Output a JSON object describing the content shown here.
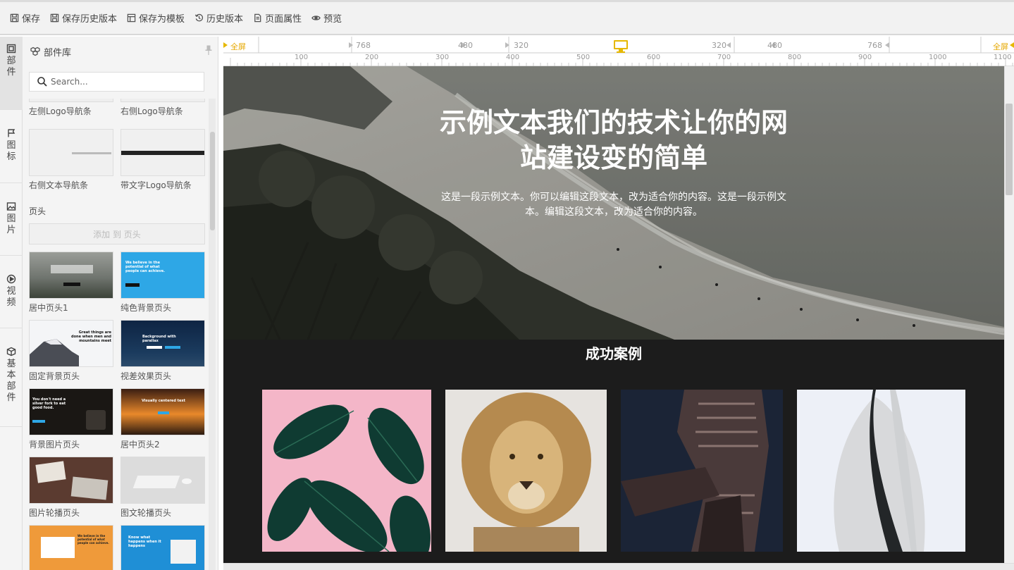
{
  "toolbar": {
    "save": "保存",
    "save_history": "保存历史版本",
    "save_template": "保存为模板",
    "history": "历史版本",
    "page_props": "页面属性",
    "preview": "预览"
  },
  "rail": {
    "tabs": [
      "部件",
      "图标",
      "图片",
      "视频",
      "基本部件"
    ]
  },
  "panel": {
    "title": "部件库",
    "search_placeholder": "Search...",
    "nav_items": [
      "左侧Logo导航条",
      "右侧Logo导航条",
      "右侧文本导航条",
      "带文字Logo导航条"
    ],
    "section_header": "页头",
    "add_to_header": "添加 到 页头",
    "header_items": [
      "居中页头1",
      "纯色背景页头",
      "固定背景页头",
      "视差效果页头",
      "背景图片页头",
      "居中页头2",
      "图片轮播页头",
      "图文轮播页头"
    ],
    "thumb_texts": {
      "solid": "We believe in the potential of what people can achieve.",
      "fixed": "Great things are done when men and mountains meet",
      "parallax": "Background with parallax",
      "bgimage": "You don't need a silver fork to eat good food.",
      "center2": "Visually centered text",
      "slide2": "We believe in the potential of what people can achieve.",
      "slide3": "Know what happens when it happens"
    }
  },
  "ruler": {
    "full_left": "全屏",
    "full_right": "全屏",
    "breakpoints": [
      "768",
      "480",
      "320",
      "320",
      "480",
      "768"
    ],
    "ticks": [
      "100",
      "200",
      "300",
      "400",
      "500",
      "600",
      "700",
      "800",
      "900",
      "1000",
      "1100"
    ]
  },
  "hero": {
    "title": "示例文本我们的技术让你的网站建设变的简单",
    "text": "这是一段示例文本。你可以编辑这段文本，改为适合你的内容。这是一段示例文本。编辑这段文本，改为适合你的内容。"
  },
  "cases": {
    "title": "成功案例"
  },
  "colors": {
    "accent_yellow": "#e6b800",
    "blue_thumb": "#2ea7e6",
    "dark_page": "#1c1c1c"
  }
}
